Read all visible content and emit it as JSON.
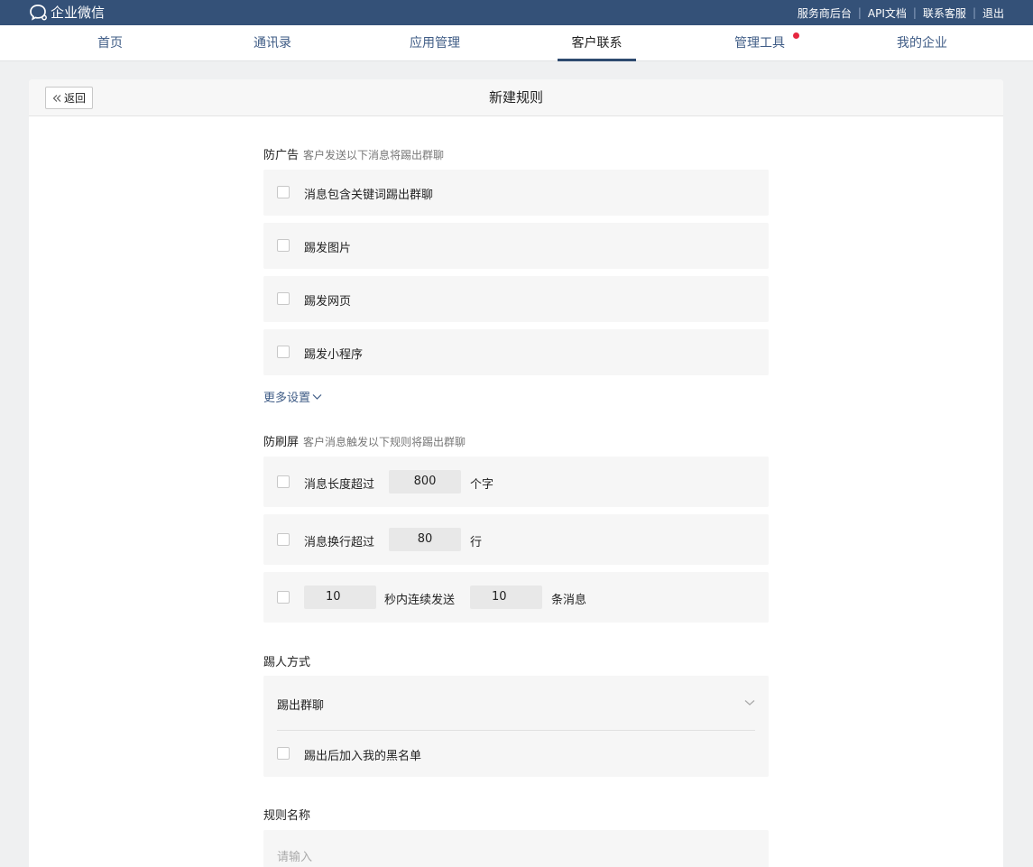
{
  "brand": {
    "name": "企业微信"
  },
  "top_links": [
    "服务商后台",
    "API文档",
    "联系客服",
    "退出"
  ],
  "nav": {
    "items": [
      "首页",
      "通讯录",
      "应用管理",
      "客户联系",
      "管理工具",
      "我的企业"
    ],
    "active": "客户联系"
  },
  "header": {
    "back_label": "返回",
    "title": "新建规则"
  },
  "anti_ad": {
    "title": "防广告",
    "desc": "客户发送以下消息将踢出群聊",
    "options": [
      "消息包含关键词踢出群聊",
      "踢发图片",
      "踢发网页",
      "踢发小程序"
    ],
    "more_label": "更多设置"
  },
  "anti_spam": {
    "title": "防刷屏",
    "desc": "客户消息触发以下规则将踢出群聊",
    "length": {
      "label": "消息长度超过",
      "value": "800",
      "unit": "个字"
    },
    "lines": {
      "label": "消息换行超过",
      "value": "80",
      "unit": "行"
    },
    "burst": {
      "seconds": "10",
      "mid_label": "秒内连续发送",
      "count": "10",
      "unit": "条消息"
    }
  },
  "kick": {
    "title": "踢人方式",
    "selected": "踢出群聊",
    "blacklist_label": "踢出后加入我的黑名单"
  },
  "rule_name": {
    "title": "规则名称",
    "placeholder": "请输入"
  },
  "colors": {
    "topbar": "#345178",
    "link": "#3f5c86",
    "notice_dot": "#e6263f"
  }
}
